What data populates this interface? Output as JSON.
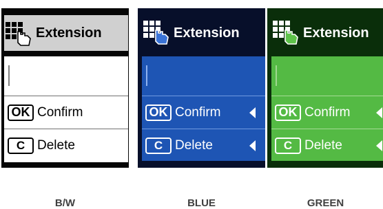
{
  "panels": [
    {
      "theme": "bw",
      "title": "Extension",
      "icon": "keypad-hand-icon",
      "confirm_key": "OK",
      "confirm_label": "Confirm",
      "delete_key": "C",
      "delete_label": "Delete",
      "caption": "B/W",
      "colors": {
        "screen": "#ffffff",
        "header": "#d0d0d0"
      }
    },
    {
      "theme": "blue",
      "title": "Extension",
      "icon": "keypad-hand-icon",
      "confirm_key": "OK",
      "confirm_label": "Confirm",
      "delete_key": "C",
      "delete_label": "Delete",
      "caption": "BLUE",
      "colors": {
        "screen": "#1e55b4",
        "frame": "#070f2a"
      }
    },
    {
      "theme": "green",
      "title": "Extension",
      "icon": "keypad-hand-icon",
      "confirm_key": "OK",
      "confirm_label": "Confirm",
      "delete_key": "C",
      "delete_label": "Delete",
      "caption": "GREEN",
      "colors": {
        "screen": "#54ba44",
        "frame": "#0a2e0a"
      }
    }
  ]
}
